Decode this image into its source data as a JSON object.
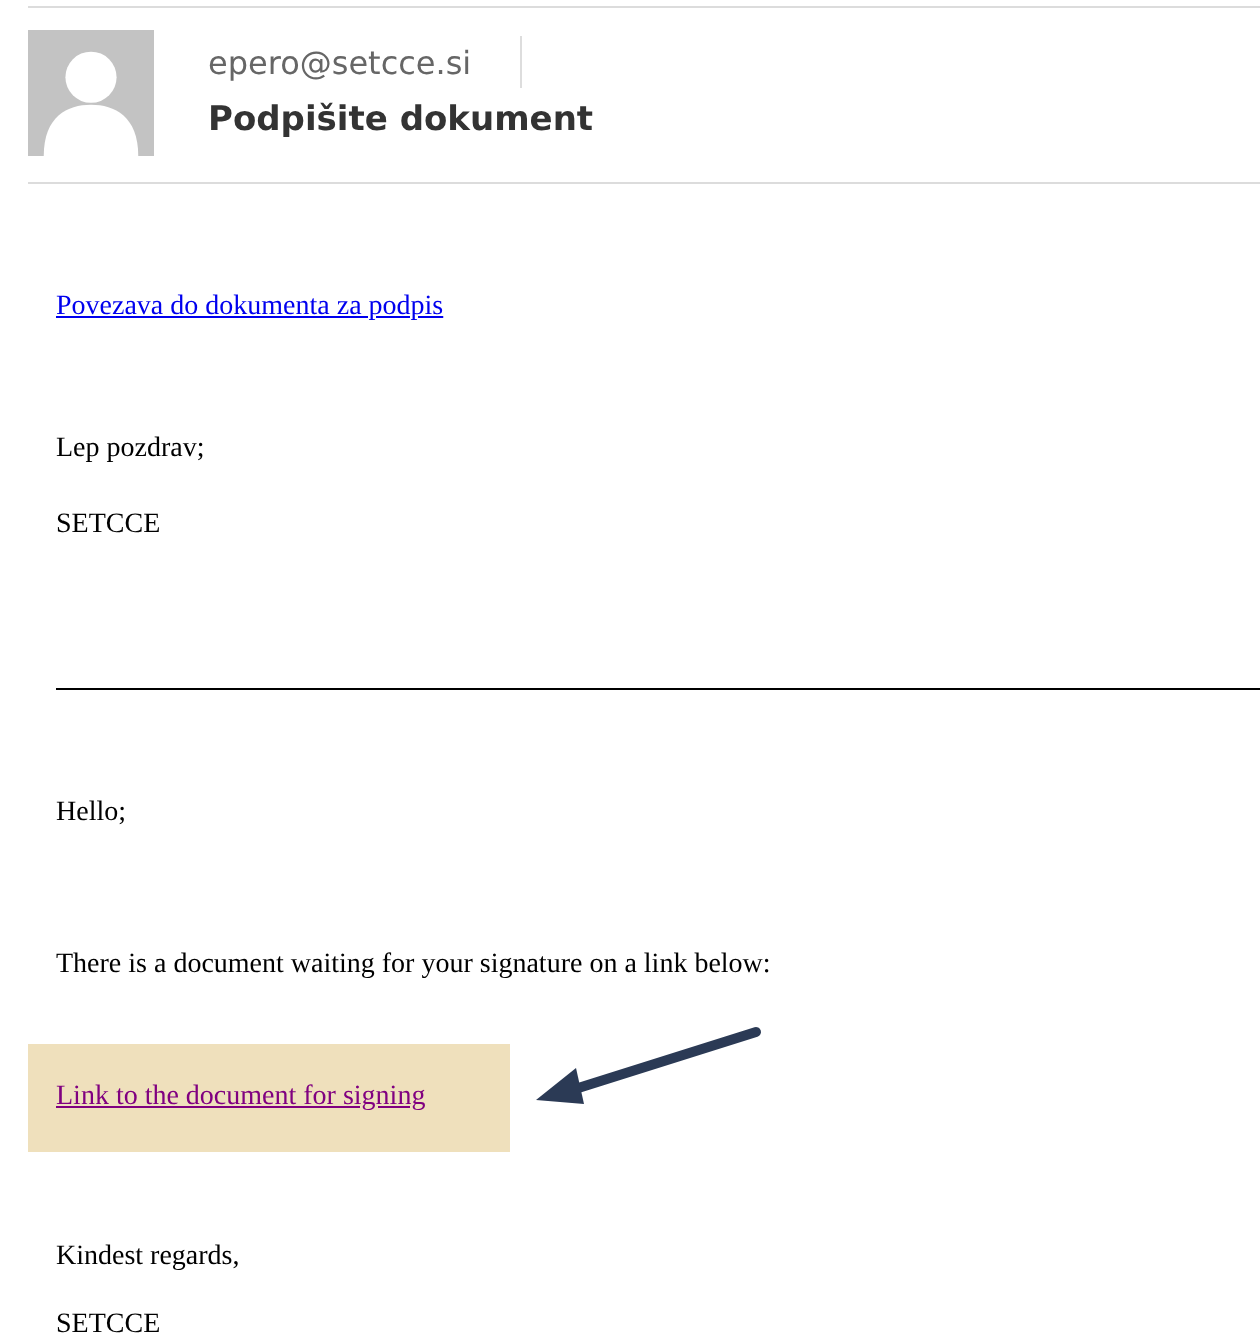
{
  "header": {
    "sender": "epero@setcce.si",
    "subject": "Podpišite dokument"
  },
  "body": [
    {
      "kind": "link",
      "text": "Povezava do dokumenta za podpis",
      "visited": false,
      "highlighted": false
    },
    {
      "kind": "text",
      "text": "Lep pozdrav;"
    },
    {
      "kind": "text",
      "text": "SETCCE"
    },
    {
      "kind": "rule"
    },
    {
      "kind": "text",
      "text": "Hello;"
    },
    {
      "kind": "text",
      "text": "There is a document waiting for your signature on a link below:"
    },
    {
      "kind": "link",
      "text": "Link to the document for signing",
      "visited": true,
      "highlighted": true
    },
    {
      "kind": "text",
      "text": "Kindest regards,"
    },
    {
      "kind": "text",
      "text": "SETCCE"
    }
  ]
}
